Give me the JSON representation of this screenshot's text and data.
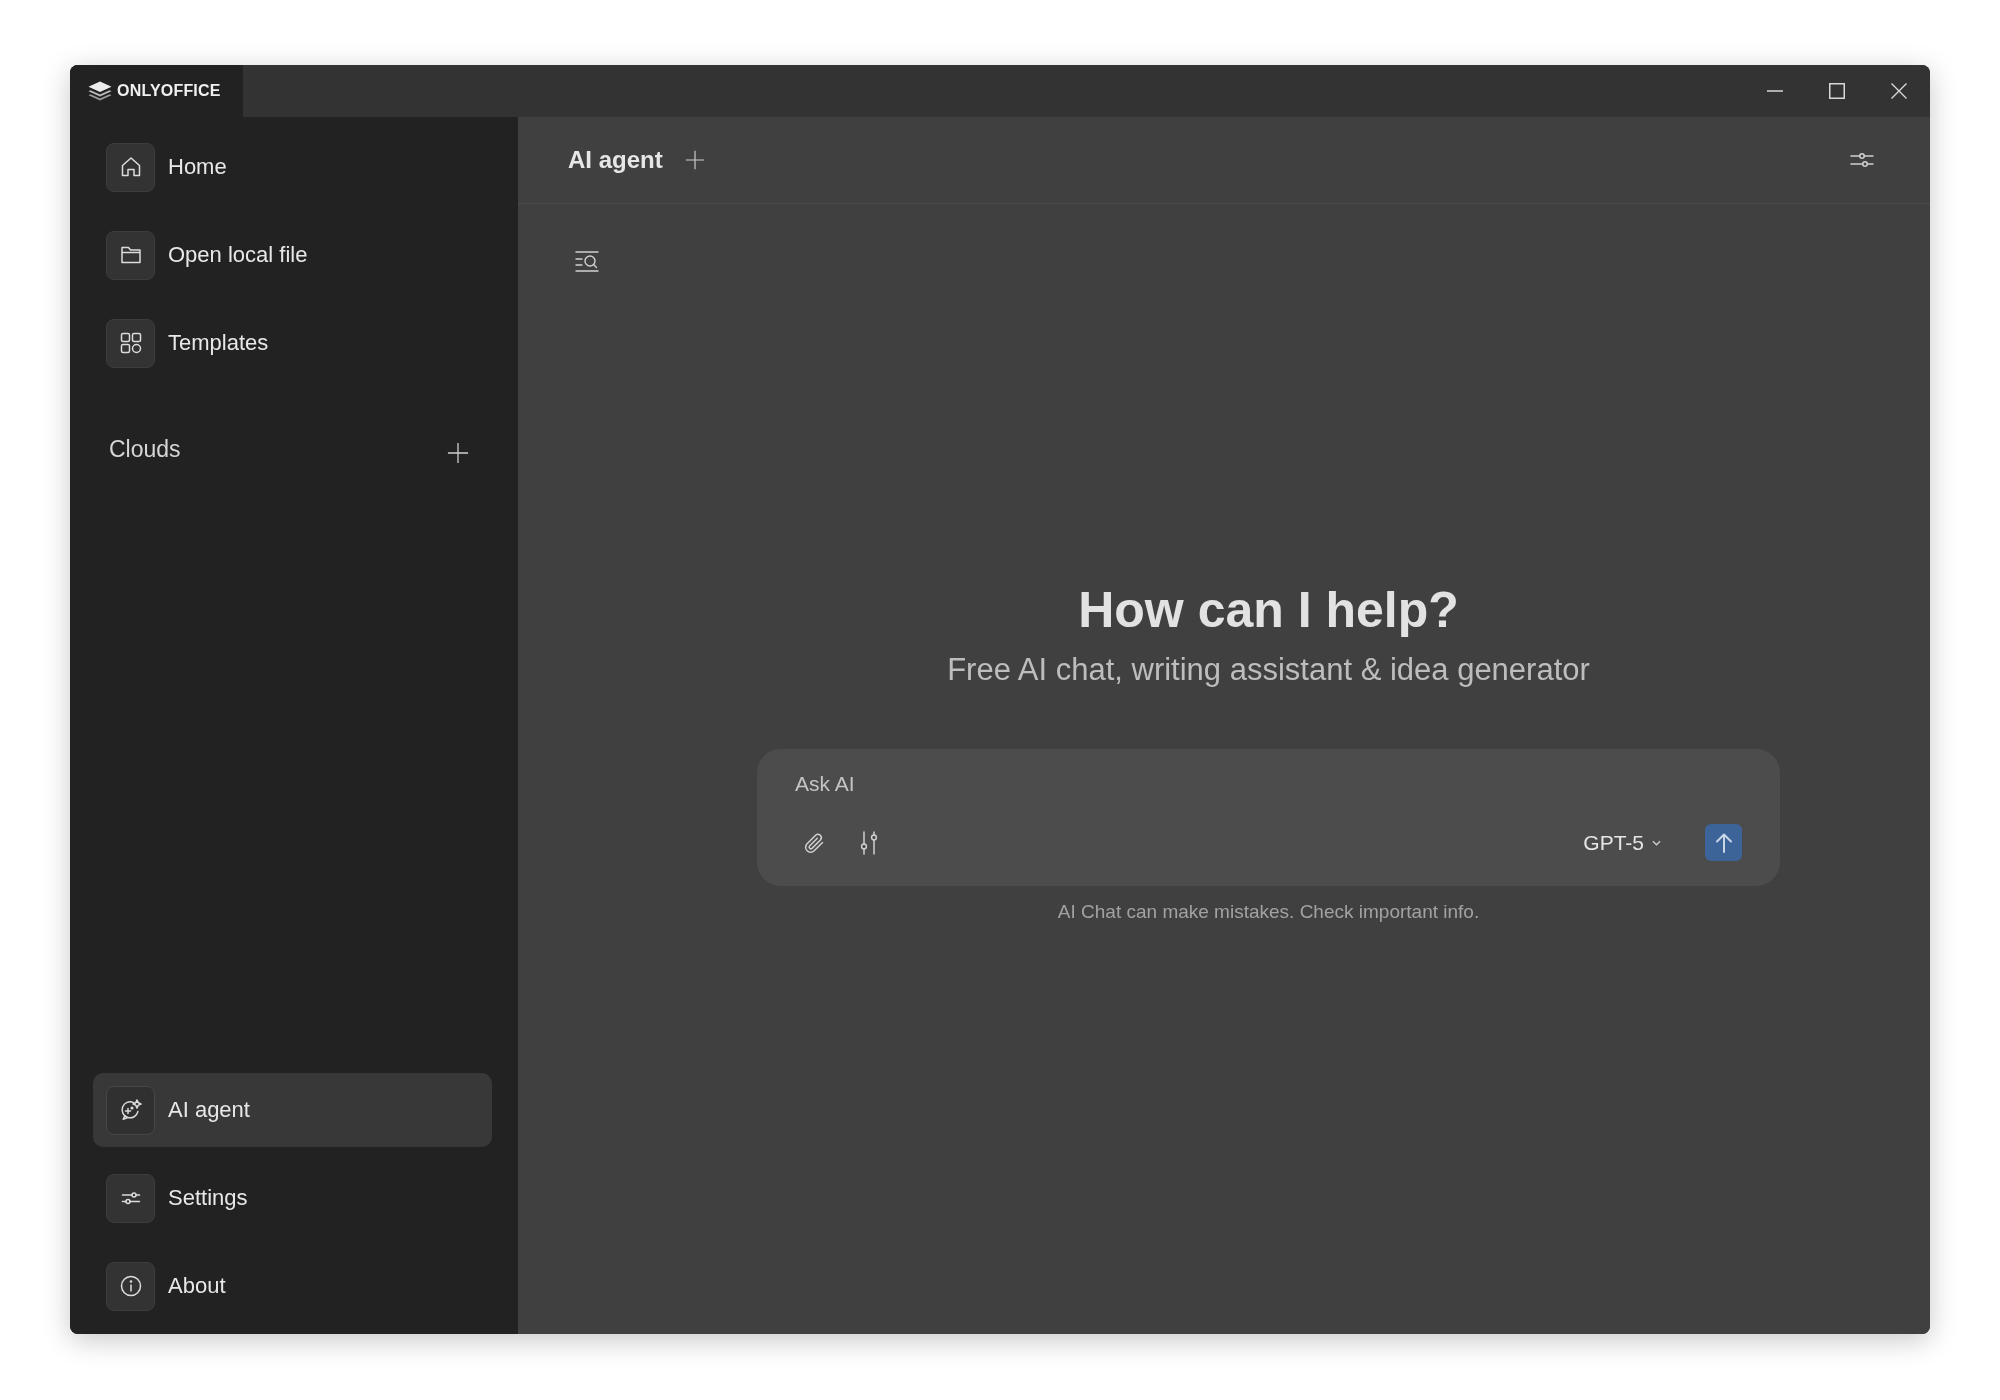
{
  "window": {
    "app_name": "ONLYOFFICE"
  },
  "sidebar": {
    "top_items": [
      {
        "label": "Home",
        "selected": false
      },
      {
        "label": "Open local file",
        "selected": false
      },
      {
        "label": "Templates",
        "selected": false
      }
    ],
    "clouds": {
      "label": "Clouds"
    },
    "bottom_items": [
      {
        "label": "AI agent",
        "selected": true
      },
      {
        "label": "Settings",
        "selected": false
      },
      {
        "label": "About",
        "selected": false
      }
    ]
  },
  "main": {
    "header": {
      "title": "AI agent"
    },
    "heading": "How can I help?",
    "subheading": "Free AI chat, writing assistant & idea generator",
    "composer": {
      "placeholder": "Ask AI",
      "model": "GPT-5"
    },
    "disclaimer": "AI Chat can make mistakes. Check important info."
  }
}
